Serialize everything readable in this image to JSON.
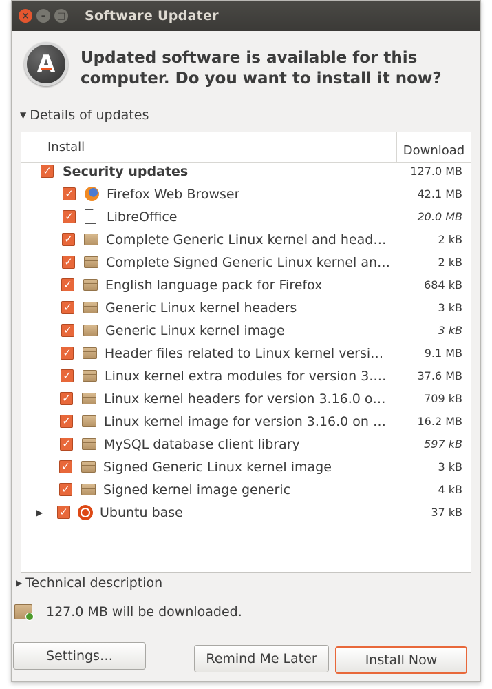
{
  "window": {
    "title": "Software Updater"
  },
  "header": {
    "message": "Updated software is available for this computer. Do you want to install it now?"
  },
  "details_expander": {
    "label": "Details of updates",
    "expanded": true
  },
  "columns": {
    "install": "Install",
    "download": "Download"
  },
  "groups": [
    {
      "label": "Security updates",
      "size": "127.0 MB",
      "checked": true,
      "expanded": true,
      "items": [
        {
          "label": "Firefox Web Browser",
          "size": "42.1 MB",
          "icon": "firefox-icon",
          "checked": true
        },
        {
          "label": "LibreOffice",
          "size": "20.0 MB",
          "icon": "document-icon",
          "checked": true
        },
        {
          "label": "Complete Generic Linux kernel and head…",
          "size": "2 kB",
          "icon": "package-icon",
          "checked": true
        },
        {
          "label": "Complete Signed Generic Linux kernel an…",
          "size": "2 kB",
          "icon": "package-icon",
          "checked": true
        },
        {
          "label": "English language pack for Firefox",
          "size": "684 kB",
          "icon": "package-icon",
          "checked": true
        },
        {
          "label": "Generic Linux kernel headers",
          "size": "3 kB",
          "icon": "package-icon",
          "checked": true
        },
        {
          "label": "Generic Linux kernel image",
          "size": "3 kB",
          "icon": "package-icon",
          "checked": true
        },
        {
          "label": "Header files related to Linux kernel versi…",
          "size": "9.1 MB",
          "icon": "package-icon",
          "checked": true
        },
        {
          "label": "Linux kernel extra modules for version 3.…",
          "size": "37.6 MB",
          "icon": "package-icon",
          "checked": true
        },
        {
          "label": "Linux kernel headers for version 3.16.0 o…",
          "size": "709 kB",
          "icon": "package-icon",
          "checked": true
        },
        {
          "label": "Linux kernel image for version 3.16.0 on …",
          "size": "16.2 MB",
          "icon": "package-icon",
          "checked": true
        },
        {
          "label": "MySQL database client library",
          "size": "597 kB",
          "icon": "package-icon",
          "checked": true
        },
        {
          "label": "Signed Generic Linux kernel image",
          "size": "3 kB",
          "icon": "package-icon",
          "checked": true
        },
        {
          "label": "Signed kernel image generic",
          "size": "4 kB",
          "icon": "package-icon",
          "checked": true
        }
      ]
    },
    {
      "label": "Ubuntu base",
      "size": "37 kB",
      "checked": true,
      "expanded": false,
      "icon": "ubuntu-icon",
      "items": []
    }
  ],
  "technical_expander": {
    "label": "Technical description",
    "expanded": false
  },
  "status": {
    "text": "127.0 MB will be downloaded."
  },
  "buttons": {
    "settings": "Settings…",
    "remind": "Remind Me Later",
    "install": "Install Now"
  },
  "colors": {
    "accent": "#e8683a",
    "titlebar": "#3b3a37",
    "close": "#e4562f"
  }
}
